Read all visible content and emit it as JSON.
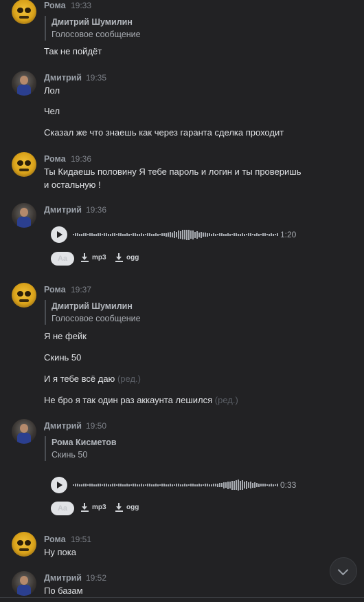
{
  "messages": [
    {
      "author": "Рома",
      "time": "19:33",
      "quote": {
        "name": "Дмитрий Шумилин",
        "text": "Голосовое сообщение"
      },
      "lines": [
        "Так не пойдёт"
      ]
    },
    {
      "author": "Дмитрий",
      "time": "19:35",
      "lines": [
        "Лол",
        "Чел",
        "Сказал же что знаешь как через гаранта сделка проходит"
      ]
    },
    {
      "author": "Рома",
      "time": "19:36",
      "lines": [
        "Ты Кидаешь половину Я тебе пароль и логин и ты проверишь",
        "и остальную !"
      ]
    },
    {
      "author": "Дмитрий",
      "time": "19:36",
      "voice": {
        "duration": "1:20",
        "transcribe_label": "Aa",
        "mp3_label": "mp3",
        "ogg_label": "ogg"
      }
    },
    {
      "author": "Рома",
      "time": "19:37",
      "quote": {
        "name": "Дмитрий Шумилин",
        "text": "Голосовое сообщение"
      },
      "lines": [
        "Я не фейк",
        "Скинь 50",
        "И я тебе всё даю",
        "Не бро я так один раз аккаунта лешился"
      ],
      "edited_label": "(ред.)"
    },
    {
      "author": "Дмитрий",
      "time": "19:50",
      "quote": {
        "name": "Рома Кисметов",
        "text": "Скинь 50"
      },
      "voice": {
        "duration": "0:33",
        "transcribe_label": "Aa",
        "mp3_label": "mp3",
        "ogg_label": "ogg"
      }
    },
    {
      "author": "Рома",
      "time": "19:51",
      "lines": [
        "Ну пока"
      ]
    },
    {
      "author": "Дмитрий",
      "time": "19:52",
      "lines": [
        "По базам"
      ]
    }
  ],
  "icons": {
    "scroll_down": "chevron-down-icon",
    "play": "play-icon",
    "download": "download-icon"
  }
}
